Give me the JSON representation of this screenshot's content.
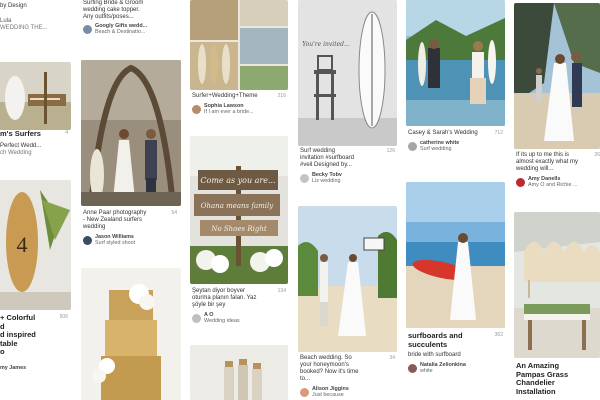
{
  "col1": {
    "top_lines": [
      "by Design",
      "",
      "Lula",
      "WEDDING THE..."
    ],
    "pin2": {
      "title": "m's Surfers",
      "stat": "4",
      "line1": "Perfect Wedd...",
      "line2": "ch Wedding"
    },
    "pin3": {
      "title": "+ Colorful",
      "stat": "506",
      "lines": [
        "d",
        "d inspired",
        "table",
        "o",
        "",
        "my James"
      ]
    }
  },
  "col2": {
    "pin1": {
      "desc": [
        "Surfing Bride & Groom",
        "wedding cake topper.",
        "Any outfits/poses..."
      ],
      "user": "Googly Gifts wedd...",
      "sub": "Beach & Destinatio..."
    },
    "pin2": {
      "desc": [
        "Anne Paar photography",
        "- New Zealand surfers",
        "wedding"
      ],
      "stat": "54",
      "user": "Jason Williams",
      "sub": "Surf styled shoot"
    }
  },
  "col3": {
    "pin1": {
      "desc": "Surfer+Wedding+Theme",
      "stat": "216",
      "user": "Sophia Lawson",
      "sub": "If I am ever a bride..."
    },
    "pin2": {
      "sign1": "Come as you are...",
      "sign2": "Ohana means family",
      "sign3": "No Shoes Right",
      "desc": [
        "Şeytan diyor boyver",
        "oturma planın falan. Yaz",
        "şöyle bir şey"
      ],
      "stat": "134",
      "user": "A O",
      "sub": "Wedding ideas"
    }
  },
  "col4": {
    "pin1": {
      "invite": "You're invited...",
      "desc": [
        "Surf wedding",
        "invitation #surfboard",
        "#veil Designed by..."
      ],
      "stat": "126",
      "user": "Becky Tobv",
      "sub": "Liz wedding"
    },
    "pin2": {
      "desc": [
        "Beach wedding. So",
        "your honeymoon's",
        "booked? Now it's time",
        "to..."
      ],
      "stat": "34",
      "user": "Alison Jiggins",
      "sub": "Just because"
    }
  },
  "col5": {
    "pin1": {
      "desc": "Casey & Sarah's Wedding",
      "stat": "712",
      "user": "catherine white",
      "sub": "Surf wedding"
    },
    "pin2": {
      "title1": "surfboards and",
      "title2": "succulents",
      "stat": "362",
      "line": "bride with surfboard",
      "user": "Natalia Zelionkina",
      "sub": "white"
    }
  },
  "col6": {
    "pin1": {
      "desc": [
        "If its up to me this is",
        "almost exactly what my",
        "wedding will..."
      ],
      "stat": "26",
      "user": "Amy Danells",
      "sub": "Amy O and Richie ..."
    },
    "pin2": {
      "title": [
        "An Amazing",
        "Pampas Grass",
        "Chandelier",
        "Installation"
      ]
    }
  },
  "colors": {
    "accent": "#e60023",
    "muted": "#999999"
  }
}
